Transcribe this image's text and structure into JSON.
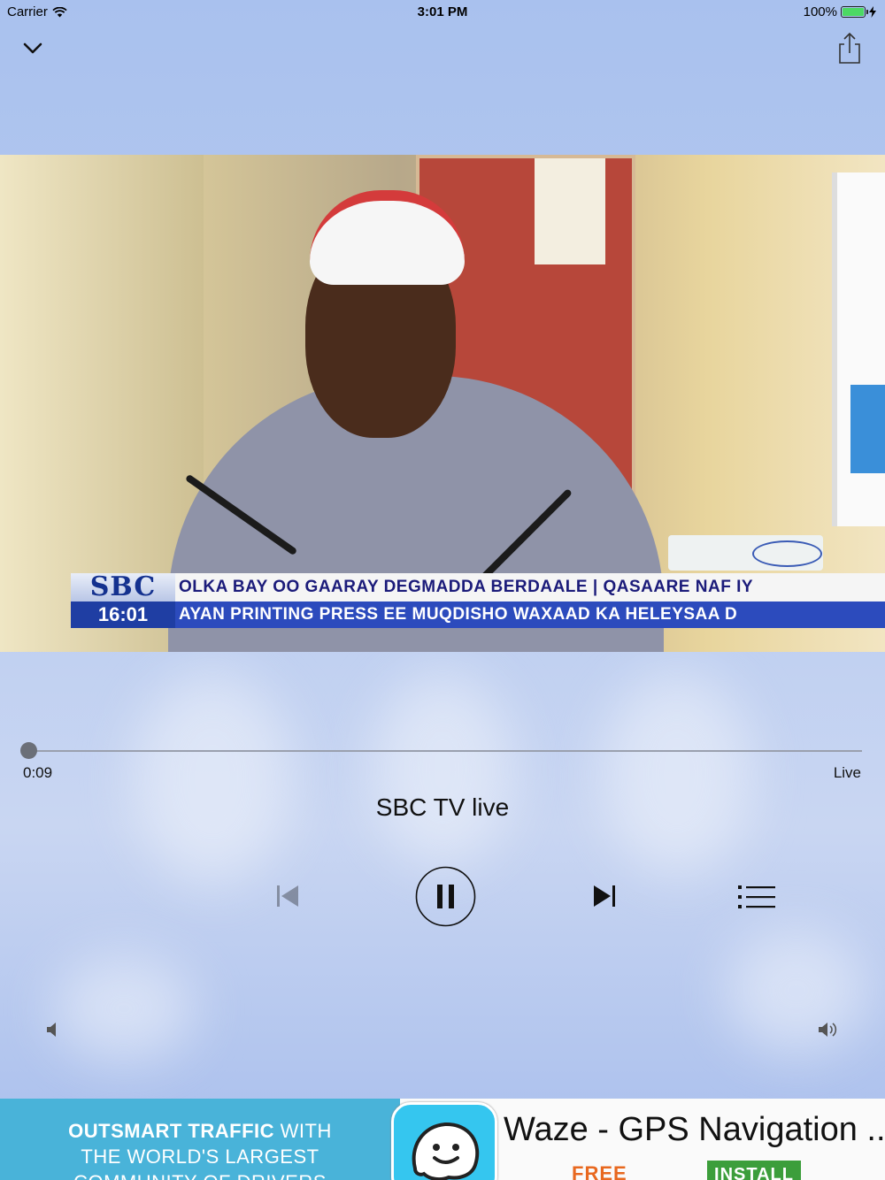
{
  "status_bar": {
    "carrier": "Carrier",
    "time": "3:01 PM",
    "battery": "100%",
    "battery_level": 1.0
  },
  "top_bar": {
    "collapse_icon": "chevron-down-icon",
    "share_icon": "share-icon"
  },
  "video": {
    "ticker_logo": "SBC",
    "ticker_time": "16:01",
    "ticker_line1": "OLKA BAY OO GAARAY DEGMADDA BERDAALE | QASAARE NAF IY",
    "ticker_line2": "AYAN PRINTING PRESS EE MUQDISHO WAXAAD KA HELEYSAA D"
  },
  "player": {
    "elapsed": "0:09",
    "duration_label": "Live",
    "progress": 0.0,
    "title": "SBC TV live",
    "controls": {
      "previous_icon": "skip-previous-icon",
      "pause_icon": "pause-icon",
      "next_icon": "skip-next-icon",
      "playlist_icon": "list-icon"
    },
    "volume": {
      "low_icon": "volume-low-icon",
      "high_icon": "volume-high-icon"
    }
  },
  "ad": {
    "headline_bold": "OUTSMART TRAFFIC",
    "headline_rest": " WITH",
    "line2": "THE WORLD'S LARGEST",
    "line3": "COMMUNITY OF DRIVERS",
    "app_name": "Waze - GPS Navigation ...",
    "price": "FREE",
    "install_label": "INSTALL",
    "colors": {
      "banner": "#49b3d9",
      "install": "#3c9e3b",
      "price": "#e8681f"
    }
  }
}
